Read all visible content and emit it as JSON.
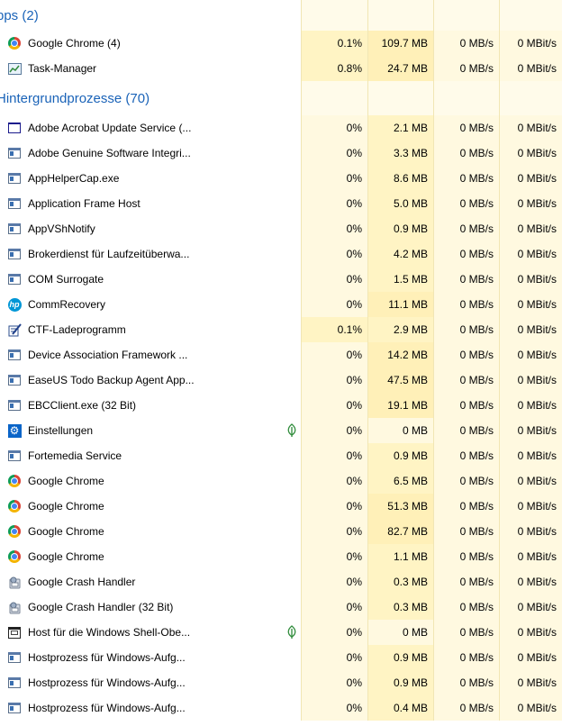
{
  "groups": [
    {
      "label": "pps (2)"
    },
    {
      "label": "Hintergrundprozesse (70)"
    }
  ],
  "apps": [
    {
      "name": "Google Chrome (4)",
      "icon": "chrome-icon",
      "cpu": "0.1%",
      "mem": "109.7 MB",
      "disk": "0 MB/s",
      "net": "0 MBit/s"
    },
    {
      "name": "Task-Manager",
      "icon": "task-manager-icon",
      "cpu": "0.8%",
      "mem": "24.7 MB",
      "disk": "0 MB/s",
      "net": "0 MBit/s"
    }
  ],
  "background": [
    {
      "name": "Adobe Acrobat Update Service (...",
      "icon": "window-icon",
      "cpu": "0%",
      "mem": "2.1 MB",
      "disk": "0 MB/s",
      "net": "0 MBit/s"
    },
    {
      "name": "Adobe Genuine Software Integri...",
      "icon": "app-window-icon",
      "cpu": "0%",
      "mem": "3.3 MB",
      "disk": "0 MB/s",
      "net": "0 MBit/s"
    },
    {
      "name": "AppHelperCap.exe",
      "icon": "app-window-icon",
      "cpu": "0%",
      "mem": "8.6 MB",
      "disk": "0 MB/s",
      "net": "0 MBit/s"
    },
    {
      "name": "Application Frame Host",
      "icon": "app-window-icon",
      "cpu": "0%",
      "mem": "5.0 MB",
      "disk": "0 MB/s",
      "net": "0 MBit/s"
    },
    {
      "name": "AppVShNotify",
      "icon": "app-window-icon",
      "cpu": "0%",
      "mem": "0.9 MB",
      "disk": "0 MB/s",
      "net": "0 MBit/s"
    },
    {
      "name": "Brokerdienst für Laufzeitüberwa...",
      "icon": "app-window-icon",
      "cpu": "0%",
      "mem": "4.2 MB",
      "disk": "0 MB/s",
      "net": "0 MBit/s"
    },
    {
      "name": "COM Surrogate",
      "icon": "app-window-icon",
      "cpu": "0%",
      "mem": "1.5 MB",
      "disk": "0 MB/s",
      "net": "0 MBit/s"
    },
    {
      "name": "CommRecovery",
      "icon": "hp-icon",
      "cpu": "0%",
      "mem": "11.1 MB",
      "disk": "0 MB/s",
      "net": "0 MBit/s"
    },
    {
      "name": "CTF-Ladeprogramm",
      "icon": "ctf-icon",
      "cpu": "0.1%",
      "mem": "2.9 MB",
      "disk": "0 MB/s",
      "net": "0 MBit/s"
    },
    {
      "name": "Device Association Framework ...",
      "icon": "app-window-icon",
      "cpu": "0%",
      "mem": "14.2 MB",
      "disk": "0 MB/s",
      "net": "0 MBit/s"
    },
    {
      "name": "EaseUS Todo Backup Agent App...",
      "icon": "app-window-icon",
      "cpu": "0%",
      "mem": "47.5 MB",
      "disk": "0 MB/s",
      "net": "0 MBit/s"
    },
    {
      "name": "EBCClient.exe (32 Bit)",
      "icon": "app-window-icon",
      "cpu": "0%",
      "mem": "19.1 MB",
      "disk": "0 MB/s",
      "net": "0 MBit/s"
    },
    {
      "name": "Einstellungen",
      "icon": "gear-icon",
      "cpu": "0%",
      "mem": "0 MB",
      "disk": "0 MB/s",
      "net": "0 MBit/s",
      "suspended": true
    },
    {
      "name": "Fortemedia Service",
      "icon": "app-window-icon",
      "cpu": "0%",
      "mem": "0.9 MB",
      "disk": "0 MB/s",
      "net": "0 MBit/s"
    },
    {
      "name": "Google Chrome",
      "icon": "chrome-icon",
      "cpu": "0%",
      "mem": "6.5 MB",
      "disk": "0 MB/s",
      "net": "0 MBit/s"
    },
    {
      "name": "Google Chrome",
      "icon": "chrome-icon",
      "cpu": "0%",
      "mem": "51.3 MB",
      "disk": "0 MB/s",
      "net": "0 MBit/s"
    },
    {
      "name": "Google Chrome",
      "icon": "chrome-icon",
      "cpu": "0%",
      "mem": "82.7 MB",
      "disk": "0 MB/s",
      "net": "0 MBit/s"
    },
    {
      "name": "Google Chrome",
      "icon": "chrome-icon",
      "cpu": "0%",
      "mem": "1.1 MB",
      "disk": "0 MB/s",
      "net": "0 MBit/s"
    },
    {
      "name": "Google Crash Handler",
      "icon": "crash-handler-icon",
      "cpu": "0%",
      "mem": "0.3 MB",
      "disk": "0 MB/s",
      "net": "0 MBit/s"
    },
    {
      "name": "Google Crash Handler (32 Bit)",
      "icon": "crash-handler-icon",
      "cpu": "0%",
      "mem": "0.3 MB",
      "disk": "0 MB/s",
      "net": "0 MBit/s"
    },
    {
      "name": "Host für die Windows Shell-Obe...",
      "icon": "shell-window-icon",
      "cpu": "0%",
      "mem": "0 MB",
      "disk": "0 MB/s",
      "net": "0 MBit/s",
      "suspended": true
    },
    {
      "name": "Hostprozess für Windows-Aufg...",
      "icon": "app-window-icon",
      "cpu": "0%",
      "mem": "0.9 MB",
      "disk": "0 MB/s",
      "net": "0 MBit/s"
    },
    {
      "name": "Hostprozess für Windows-Aufg...",
      "icon": "app-window-icon",
      "cpu": "0%",
      "mem": "0.9 MB",
      "disk": "0 MB/s",
      "net": "0 MBit/s"
    },
    {
      "name": "Hostprozess für Windows-Aufg...",
      "icon": "app-window-icon",
      "cpu": "0%",
      "mem": "0.4 MB",
      "disk": "0 MB/s",
      "net": "0 MBit/s"
    }
  ],
  "colors": {
    "group_header": "#1a63b8",
    "heat_light": "#fff9e0",
    "heat_medium": "#fff4c4",
    "heat_dark": "#fff0b8"
  }
}
